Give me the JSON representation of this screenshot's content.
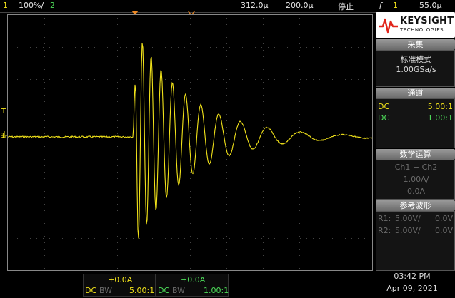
{
  "topbar": {
    "ch1_number": "1",
    "ch1_scale": "100%/",
    "ch2_number": "2",
    "timebase": "312.0µ",
    "delay": "200.0µ",
    "run_state": "停止",
    "trigger_symbol": "ƒ",
    "trigger_channel": "1",
    "trigger_level": "55.0µ"
  },
  "brand": {
    "name": "KEYSIGHT",
    "sub": "TECHNOLOGIES",
    "color": "#e1251b"
  },
  "acquire": {
    "title": "采集",
    "mode": "标准模式",
    "rate": "1.00GSa/s"
  },
  "channels": {
    "title": "通道",
    "rows": [
      {
        "coupling": "DC",
        "probe": "5.00:1",
        "color": "#f2e31a"
      },
      {
        "coupling": "DC",
        "probe": "1.00:1",
        "color": "#4ede5a"
      }
    ]
  },
  "math": {
    "title": "数学运算",
    "expr": "Ch1 + Ch2",
    "scale": "1.00A/",
    "offset": "0.0A"
  },
  "ref": {
    "title": "参考波形",
    "rows": [
      {
        "label": "R1:",
        "scale": "5.00V/",
        "offset": "0.0V"
      },
      {
        "label": "R2:",
        "scale": "5.00V/",
        "offset": "0.0V"
      }
    ]
  },
  "bottom": {
    "ch1": {
      "offset": "+0.0A",
      "coupling": "DC",
      "bw": "BW",
      "probe": "5.00:1"
    },
    "ch2": {
      "offset": "+0.0A",
      "coupling": "DC",
      "bw": "BW",
      "probe": "1.00:1"
    }
  },
  "clock": {
    "time": "03:42 PM",
    "date": "Apr 09, 2021"
  },
  "markers": {
    "trigger": "T",
    "ch1": "1"
  },
  "colors": {
    "ch1": "#f2e31a",
    "ch2": "#4ede5a",
    "trigger_marker": "#f08a24"
  }
}
